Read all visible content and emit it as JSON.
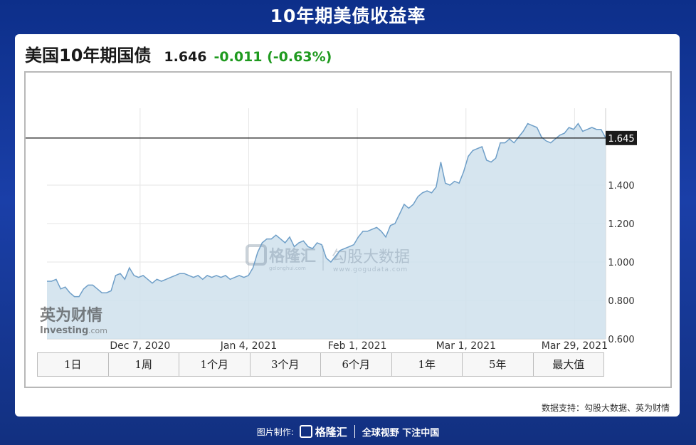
{
  "page_title": "10年期美债收益率",
  "quote": {
    "name": "美国10年期国债",
    "price": "1.646",
    "change": "-0.011 (-0.63%)"
  },
  "colors": {
    "background": "#1a3fa8",
    "line": "#6f9fc8",
    "area": "#cfe0ec",
    "change_negative": "#1f9a1f",
    "current_marker": "#1a1a1a"
  },
  "watermarks": {
    "gelonghui": "格隆汇",
    "gelonghui_url": "gelonghui.com",
    "gogudata": "勾股大数据",
    "gogudata_url": "www.gogudata.com",
    "investing_cn": "英为财情",
    "investing_en": "Investing",
    "investing_suffix": ".com"
  },
  "periods": [
    "1日",
    "1周",
    "1个月",
    "3个月",
    "6个月",
    "1年",
    "5年",
    "最大值"
  ],
  "source": "数据支持：勾股大数据、英为财情",
  "footer": {
    "made_by": "图片制作:",
    "brand": "格隆汇",
    "slogan": "全球视野 下注中国"
  },
  "chart_data": {
    "type": "area",
    "title": "美国10年期国债",
    "xlabel": "",
    "ylabel": "",
    "ylim": [
      0.6,
      1.8
    ],
    "yticks": [
      "0.600",
      "0.800",
      "1.000",
      "1.200",
      "1.400"
    ],
    "xticks": [
      "Dec 7, 2020",
      "Jan 4, 2021",
      "Feb 1, 2021",
      "Mar 1, 2021",
      "Mar 29, 2021"
    ],
    "current_label": "1.645",
    "current_value": 1.645,
    "grid": true,
    "series": [
      {
        "name": "",
        "start_date": "2020-11-13",
        "end_date": "2021-04-06",
        "values": [
          0.9,
          0.9,
          0.91,
          0.86,
          0.87,
          0.84,
          0.82,
          0.82,
          0.86,
          0.88,
          0.88,
          0.86,
          0.84,
          0.84,
          0.85,
          0.93,
          0.94,
          0.91,
          0.97,
          0.93,
          0.92,
          0.93,
          0.91,
          0.89,
          0.91,
          0.9,
          0.91,
          0.92,
          0.93,
          0.94,
          0.94,
          0.93,
          0.92,
          0.93,
          0.91,
          0.93,
          0.92,
          0.93,
          0.92,
          0.93,
          0.91,
          0.92,
          0.93,
          0.92,
          0.93,
          0.97,
          1.05,
          1.1,
          1.12,
          1.12,
          1.14,
          1.12,
          1.1,
          1.13,
          1.08,
          1.1,
          1.11,
          1.08,
          1.07,
          1.1,
          1.09,
          1.02,
          1.0,
          1.03,
          1.06,
          1.07,
          1.08,
          1.09,
          1.13,
          1.16,
          1.16,
          1.17,
          1.18,
          1.16,
          1.13,
          1.19,
          1.2,
          1.25,
          1.3,
          1.28,
          1.3,
          1.34,
          1.36,
          1.37,
          1.36,
          1.39,
          1.52,
          1.41,
          1.4,
          1.42,
          1.41,
          1.47,
          1.55,
          1.58,
          1.59,
          1.6,
          1.53,
          1.52,
          1.54,
          1.62,
          1.62,
          1.64,
          1.62,
          1.65,
          1.68,
          1.72,
          1.71,
          1.7,
          1.65,
          1.63,
          1.62,
          1.64,
          1.66,
          1.67,
          1.7,
          1.69,
          1.72,
          1.68,
          1.69,
          1.7,
          1.69,
          1.69,
          1.646
        ]
      }
    ]
  }
}
